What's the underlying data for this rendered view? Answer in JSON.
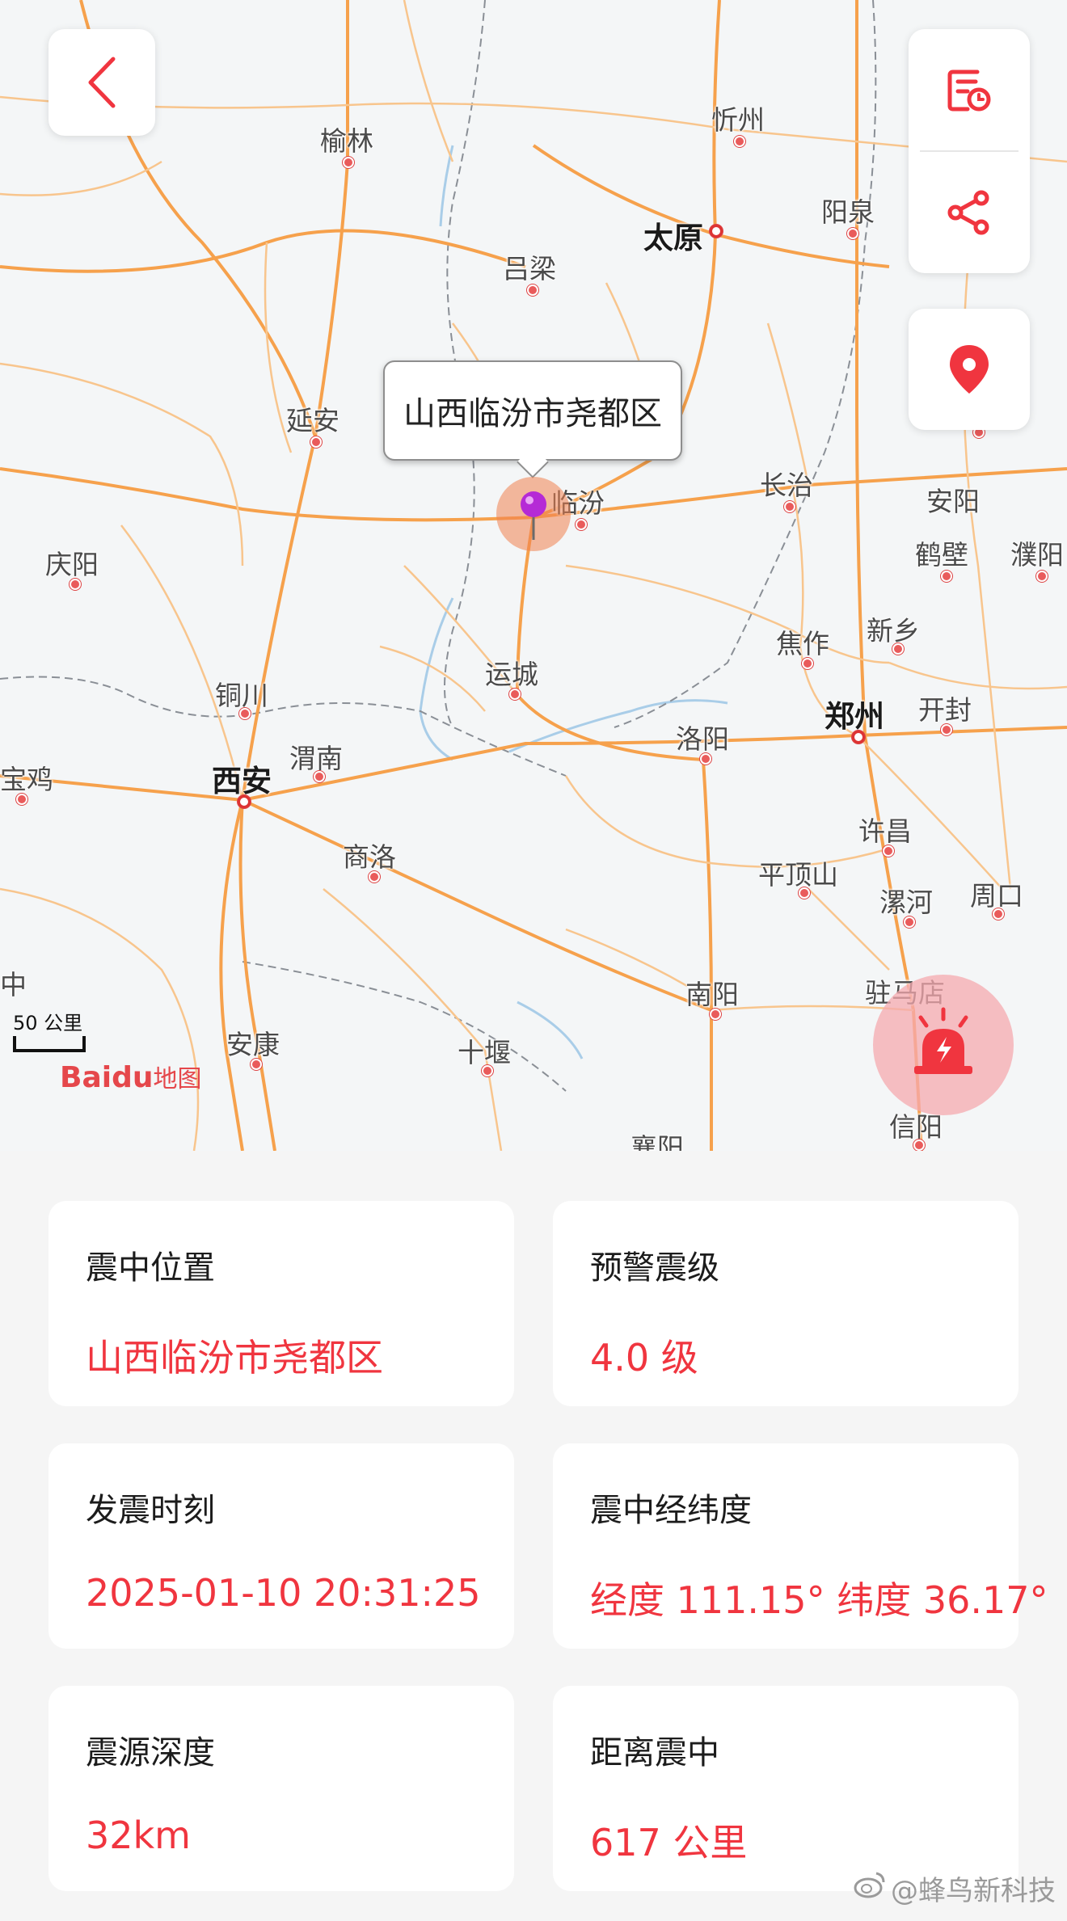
{
  "map": {
    "callout_text": "山西临汾市尧都区",
    "scale_label": "50 公里",
    "logo": {
      "brand": "Baidu",
      "suffix": "地图"
    },
    "cities": {
      "yulin": "榆林",
      "xinzhou": "忻州",
      "taiyuan": "太原",
      "yangquan": "阳泉",
      "lvliang": "吕梁",
      "yanan": "延安",
      "linfen": "临汾",
      "changzhi": "长治",
      "anyang": "安阳",
      "hebi": "鹤壁",
      "puyang": "濮阳",
      "qingyang": "庆阳",
      "jiaozuo": "焦作",
      "xinxiang": "新乡",
      "yuncheng": "运城",
      "tongchuan": "铜川",
      "zhengzhou": "郑州",
      "kaifeng": "开封",
      "baoji": "宝鸡",
      "xian": "西安",
      "weinan": "渭南",
      "luoyang": "洛阳",
      "xuchang": "许昌",
      "shangluo": "商洛",
      "pingdingshan": "平顶山",
      "luohe": "漯河",
      "zhoukou": "周口",
      "zhong": "中",
      "zhumadian": "驻马店",
      "nanyang": "南阳",
      "ankang": "安康",
      "shiyan": "十堰",
      "xinyang": "信阳",
      "xiangyang": "襄阳"
    },
    "icons": {
      "back": "chevron-left-icon",
      "record": "history-record-icon",
      "share": "share-icon",
      "locate": "location-pin-icon",
      "alarm": "siren-alarm-icon"
    },
    "accent_color": "#f0353f"
  },
  "cards": [
    {
      "label": "震中位置",
      "value": "山西临汾市尧都区"
    },
    {
      "label": "预警震级",
      "value": "4.0 级"
    },
    {
      "label": "发震时刻",
      "value": "2025-01-10 20:31:25"
    },
    {
      "label": "震中经纬度",
      "value": "经度 111.15° 纬度 36.17°"
    },
    {
      "label": "震源深度",
      "value": "32km"
    },
    {
      "label": "距离震中",
      "value": "617 公里"
    }
  ],
  "watermark": "@蜂鸟新科技"
}
